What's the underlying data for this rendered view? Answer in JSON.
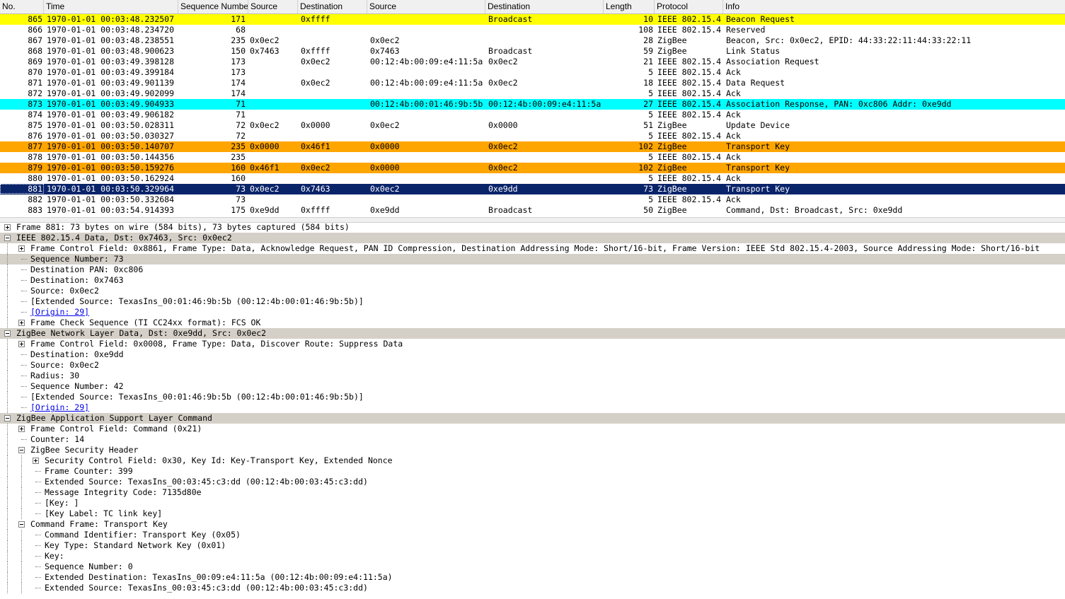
{
  "columns": [
    "No.",
    "Time",
    "Sequence Number",
    "Source",
    "Destination",
    "Source",
    "Destination",
    "Length",
    "Protocol",
    "Info"
  ],
  "packets": [
    {
      "no": "865",
      "time": "1970-01-01 00:03:48.232507",
      "seq": "171",
      "src": "",
      "dst": "0xffff",
      "src2": "",
      "dst2": "Broadcast",
      "len": "10",
      "proto": "IEEE 802.15.4",
      "info": "Beacon Request",
      "hl": "yellow"
    },
    {
      "no": "866",
      "time": "1970-01-01 00:03:48.234720",
      "seq": "68",
      "src": "",
      "dst": "",
      "src2": "",
      "dst2": "",
      "len": "108",
      "proto": "IEEE 802.15.4",
      "info": "Reserved",
      "hl": ""
    },
    {
      "no": "867",
      "time": "1970-01-01 00:03:48.238551",
      "seq": "235",
      "src": "0x0ec2",
      "dst": "",
      "src2": "0x0ec2",
      "dst2": "",
      "len": "28",
      "proto": "ZigBee",
      "info": "Beacon, Src: 0x0ec2, EPID: 44:33:22:11:44:33:22:11",
      "hl": ""
    },
    {
      "no": "868",
      "time": "1970-01-01 00:03:48.900623",
      "seq": "150",
      "src": "0x7463",
      "dst": "0xffff",
      "src2": "0x7463",
      "dst2": "Broadcast",
      "len": "59",
      "proto": "ZigBee",
      "info": "Link Status",
      "hl": ""
    },
    {
      "no": "869",
      "time": "1970-01-01 00:03:49.398128",
      "seq": "173",
      "src": "",
      "dst": "0x0ec2",
      "src2": "00:12:4b:00:09:e4:11:5a",
      "dst2": "0x0ec2",
      "len": "21",
      "proto": "IEEE 802.15.4",
      "info": "Association Request",
      "hl": ""
    },
    {
      "no": "870",
      "time": "1970-01-01 00:03:49.399184",
      "seq": "173",
      "src": "",
      "dst": "",
      "src2": "",
      "dst2": "",
      "len": "5",
      "proto": "IEEE 802.15.4",
      "info": "Ack",
      "hl": ""
    },
    {
      "no": "871",
      "time": "1970-01-01 00:03:49.901139",
      "seq": "174",
      "src": "",
      "dst": "0x0ec2",
      "src2": "00:12:4b:00:09:e4:11:5a",
      "dst2": "0x0ec2",
      "len": "18",
      "proto": "IEEE 802.15.4",
      "info": "Data Request",
      "hl": ""
    },
    {
      "no": "872",
      "time": "1970-01-01 00:03:49.902099",
      "seq": "174",
      "src": "",
      "dst": "",
      "src2": "",
      "dst2": "",
      "len": "5",
      "proto": "IEEE 802.15.4",
      "info": "Ack",
      "hl": ""
    },
    {
      "no": "873",
      "time": "1970-01-01 00:03:49.904933",
      "seq": "71",
      "src": "",
      "dst": "",
      "src2": "00:12:4b:00:01:46:9b:5b",
      "dst2": "00:12:4b:00:09:e4:11:5a",
      "len": "27",
      "proto": "IEEE 802.15.4",
      "info": "Association Response, PAN: 0xc806 Addr: 0xe9dd",
      "hl": "cyan"
    },
    {
      "no": "874",
      "time": "1970-01-01 00:03:49.906182",
      "seq": "71",
      "src": "",
      "dst": "",
      "src2": "",
      "dst2": "",
      "len": "5",
      "proto": "IEEE 802.15.4",
      "info": "Ack",
      "hl": ""
    },
    {
      "no": "875",
      "time": "1970-01-01 00:03:50.028311",
      "seq": "72",
      "src": "0x0ec2",
      "dst": "0x0000",
      "src2": "0x0ec2",
      "dst2": "0x0000",
      "len": "51",
      "proto": "ZigBee",
      "info": "Update Device",
      "hl": ""
    },
    {
      "no": "876",
      "time": "1970-01-01 00:03:50.030327",
      "seq": "72",
      "src": "",
      "dst": "",
      "src2": "",
      "dst2": "",
      "len": "5",
      "proto": "IEEE 802.15.4",
      "info": "Ack",
      "hl": ""
    },
    {
      "no": "877",
      "time": "1970-01-01 00:03:50.140707",
      "seq": "235",
      "src": "0x0000",
      "dst": "0x46f1",
      "src2": "0x0000",
      "dst2": "0x0ec2",
      "len": "102",
      "proto": "ZigBee",
      "info": "Transport Key",
      "hl": "orange"
    },
    {
      "no": "878",
      "time": "1970-01-01 00:03:50.144356",
      "seq": "235",
      "src": "",
      "dst": "",
      "src2": "",
      "dst2": "",
      "len": "5",
      "proto": "IEEE 802.15.4",
      "info": "Ack",
      "hl": ""
    },
    {
      "no": "879",
      "time": "1970-01-01 00:03:50.159276",
      "seq": "160",
      "src": "0x46f1",
      "dst": "0x0ec2",
      "src2": "0x0000",
      "dst2": "0x0ec2",
      "len": "102",
      "proto": "ZigBee",
      "info": "Transport Key",
      "hl": "orange"
    },
    {
      "no": "880",
      "time": "1970-01-01 00:03:50.162924",
      "seq": "160",
      "src": "",
      "dst": "",
      "src2": "",
      "dst2": "",
      "len": "5",
      "proto": "IEEE 802.15.4",
      "info": "Ack",
      "hl": ""
    },
    {
      "no": "881",
      "time": "1970-01-01 00:03:50.329964",
      "seq": "73",
      "src": "0x0ec2",
      "dst": "0x7463",
      "src2": "0x0ec2",
      "dst2": "0xe9dd",
      "len": "73",
      "proto": "ZigBee",
      "info": "Transport Key",
      "hl": "sel"
    },
    {
      "no": "882",
      "time": "1970-01-01 00:03:50.332684",
      "seq": "73",
      "src": "",
      "dst": "",
      "src2": "",
      "dst2": "",
      "len": "5",
      "proto": "IEEE 802.15.4",
      "info": "Ack",
      "hl": ""
    },
    {
      "no": "883",
      "time": "1970-01-01 00:03:54.914393",
      "seq": "175",
      "src": "0xe9dd",
      "dst": "0xffff",
      "src2": "0xe9dd",
      "dst2": "Broadcast",
      "len": "50",
      "proto": "ZigBee",
      "info": "Command, Dst: Broadcast, Src: 0xe9dd",
      "hl": ""
    }
  ],
  "details": [
    {
      "text": "Frame 881: 73 bytes on wire (584 bits), 73 bytes captured (584 bits)",
      "lvl": 0,
      "exp": "plus",
      "band": false,
      "link": false
    },
    {
      "text": "IEEE 802.15.4 Data, Dst: 0x7463, Src: 0x0ec2",
      "lvl": 0,
      "exp": "minus",
      "band": true,
      "link": false
    },
    {
      "text": "Frame Control Field: 0x8861, Frame Type: Data, Acknowledge Request, PAN ID Compression, Destination Addressing Mode: Short/16-bit, Frame Version: IEEE Std 802.15.4-2003, Source Addressing Mode: Short/16-bit",
      "lvl": 1,
      "exp": "plus",
      "band": false,
      "link": false
    },
    {
      "text": "Sequence Number: 73",
      "lvl": 1,
      "exp": "",
      "band": true,
      "link": false
    },
    {
      "text": "Destination PAN: 0xc806",
      "lvl": 1,
      "exp": "",
      "band": false,
      "link": false
    },
    {
      "text": "Destination: 0x7463",
      "lvl": 1,
      "exp": "",
      "band": false,
      "link": false
    },
    {
      "text": "Source: 0x0ec2",
      "lvl": 1,
      "exp": "",
      "band": false,
      "link": false
    },
    {
      "text": "[Extended Source: TexasIns_00:01:46:9b:5b (00:12:4b:00:01:46:9b:5b)]",
      "lvl": 1,
      "exp": "",
      "band": false,
      "link": false
    },
    {
      "text": "[Origin: 29]",
      "lvl": 1,
      "exp": "",
      "band": false,
      "link": true
    },
    {
      "text": "Frame Check Sequence (TI CC24xx format): FCS OK",
      "lvl": 1,
      "exp": "plus",
      "band": false,
      "link": false
    },
    {
      "text": "ZigBee Network Layer Data, Dst: 0xe9dd, Src: 0x0ec2",
      "lvl": 0,
      "exp": "minus",
      "band": true,
      "link": false
    },
    {
      "text": "Frame Control Field: 0x0008, Frame Type: Data, Discover Route: Suppress Data",
      "lvl": 1,
      "exp": "plus",
      "band": false,
      "link": false
    },
    {
      "text": "Destination: 0xe9dd",
      "lvl": 1,
      "exp": "",
      "band": false,
      "link": false
    },
    {
      "text": "Source: 0x0ec2",
      "lvl": 1,
      "exp": "",
      "band": false,
      "link": false
    },
    {
      "text": "Radius: 30",
      "lvl": 1,
      "exp": "",
      "band": false,
      "link": false
    },
    {
      "text": "Sequence Number: 42",
      "lvl": 1,
      "exp": "",
      "band": false,
      "link": false
    },
    {
      "text": "[Extended Source: TexasIns_00:01:46:9b:5b (00:12:4b:00:01:46:9b:5b)]",
      "lvl": 1,
      "exp": "",
      "band": false,
      "link": false
    },
    {
      "text": "[Origin: 29]",
      "lvl": 1,
      "exp": "",
      "band": false,
      "link": true
    },
    {
      "text": "ZigBee Application Support Layer Command",
      "lvl": 0,
      "exp": "minus",
      "band": true,
      "link": false
    },
    {
      "text": "Frame Control Field: Command (0x21)",
      "lvl": 1,
      "exp": "plus",
      "band": false,
      "link": false
    },
    {
      "text": "Counter: 14",
      "lvl": 1,
      "exp": "",
      "band": false,
      "link": false
    },
    {
      "text": "ZigBee Security Header",
      "lvl": 1,
      "exp": "minus",
      "band": false,
      "link": false
    },
    {
      "text": "Security Control Field: 0x30, Key Id: Key-Transport Key, Extended Nonce",
      "lvl": 2,
      "exp": "plus",
      "band": false,
      "link": false
    },
    {
      "text": "Frame Counter: 399",
      "lvl": 2,
      "exp": "",
      "band": false,
      "link": false
    },
    {
      "text": "Extended Source: TexasIns_00:03:45:c3:dd (00:12:4b:00:03:45:c3:dd)",
      "lvl": 2,
      "exp": "",
      "band": false,
      "link": false
    },
    {
      "text": "Message Integrity Code: 7135d80e",
      "lvl": 2,
      "exp": "",
      "band": false,
      "link": false
    },
    {
      "text": "[Key:                            ]",
      "lvl": 2,
      "exp": "",
      "band": false,
      "link": false
    },
    {
      "text": "[Key Label:      TC link key]",
      "lvl": 2,
      "exp": "",
      "band": false,
      "link": false
    },
    {
      "text": "Command Frame: Transport Key",
      "lvl": 1,
      "exp": "minus",
      "band": false,
      "link": false
    },
    {
      "text": "Command Identifier: Transport Key (0x05)",
      "lvl": 2,
      "exp": "",
      "band": false,
      "link": false
    },
    {
      "text": "Key Type: Standard Network Key (0x01)",
      "lvl": 2,
      "exp": "",
      "band": false,
      "link": false
    },
    {
      "text": "Key:",
      "lvl": 2,
      "exp": "",
      "band": false,
      "link": false
    },
    {
      "text": "Sequence Number: 0",
      "lvl": 2,
      "exp": "",
      "band": false,
      "link": false
    },
    {
      "text": "Extended Destination: TexasIns_00:09:e4:11:5a (00:12:4b:00:09:e4:11:5a)",
      "lvl": 2,
      "exp": "",
      "band": false,
      "link": false
    },
    {
      "text": "Extended Source: TexasIns_00:03:45:c3:dd (00:12:4b:00:03:45:c3:dd)",
      "lvl": 2,
      "exp": "",
      "band": false,
      "link": false
    }
  ],
  "colors": {
    "yellow": "#ffff00",
    "cyan": "#00ffff",
    "orange": "#ffa500",
    "selected": "#0a246a",
    "band": "#d4d0c8"
  }
}
